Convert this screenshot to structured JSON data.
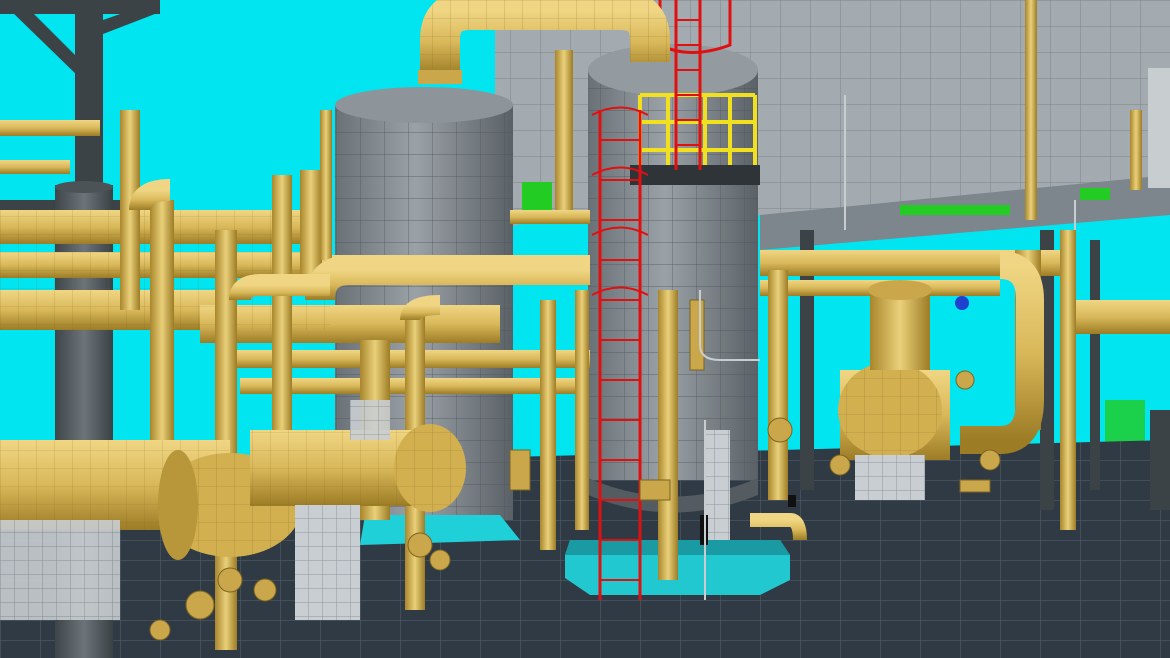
{
  "scene": {
    "kind": "3d-plant-model-render",
    "palette": {
      "sky": "#00e5f0",
      "floor": "#2f3a44",
      "floor_grid": "#5b6975",
      "building_wall": "#9aa2a8",
      "pipe": "#d9b85a",
      "pipe_shade": "#a8862c",
      "vessel": "#8b9297",
      "vessel_shade": "#5f666b",
      "ladder": "#e01010",
      "railing": "#f0e020",
      "green_panel": "#22cc22",
      "cyan_base": "#20d0d8",
      "column": "#5c6368"
    }
  }
}
